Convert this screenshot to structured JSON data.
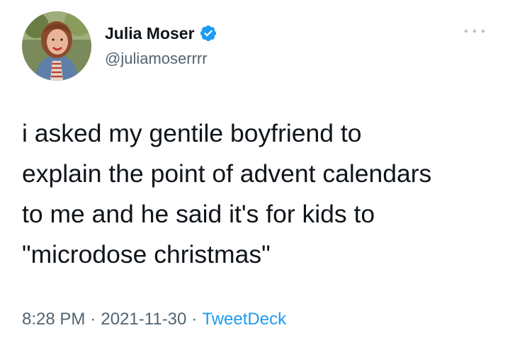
{
  "tweet": {
    "author": {
      "display_name": "Julia Moser",
      "handle": "@juliamoserrrr",
      "verified_icon": "verified-badge-icon"
    },
    "more_icon": "more-options-icon",
    "text": "i asked my gentile boyfriend to\nexplain the point of advent calendars\nto me and he said it's for kids to\n\"microdose christmas\"",
    "meta": {
      "time": "8:28 PM",
      "separator": "·",
      "date": "2021-11-30",
      "source": "TweetDeck"
    }
  },
  "colors": {
    "text": "#0f1419",
    "secondary": "#536471",
    "accent": "#1d9bf0",
    "background": "#ffffff"
  }
}
